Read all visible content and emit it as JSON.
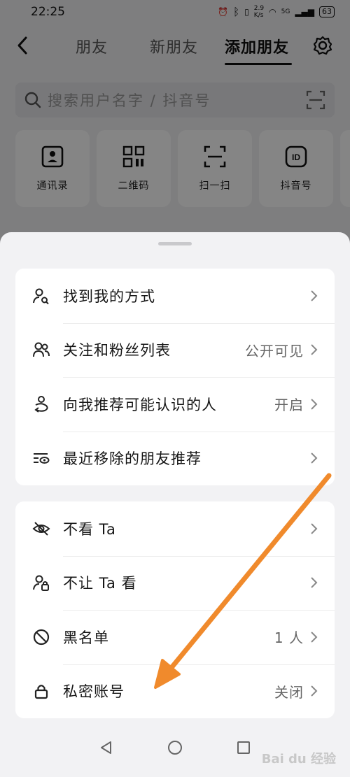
{
  "status_bar": {
    "time": "22:25",
    "net_speed_top": "2.9",
    "net_speed_unit": "K/s",
    "signal": "5G",
    "battery": "63"
  },
  "header": {
    "tabs": [
      {
        "label": "朋友"
      },
      {
        "label": "新朋友"
      },
      {
        "label": "添加朋友"
      }
    ],
    "active_tab": "添加朋友"
  },
  "search": {
    "placeholder": "搜索用户名字 / 抖音号"
  },
  "quick_actions": [
    {
      "label": "通讯录",
      "icon": "contacts-icon"
    },
    {
      "label": "二维码",
      "icon": "qr-code-icon"
    },
    {
      "label": "扫一扫",
      "icon": "scan-icon"
    },
    {
      "label": "抖音号",
      "icon": "id-icon"
    }
  ],
  "sheet": {
    "group1": [
      {
        "label": "找到我的方式",
        "value": "",
        "icon": "person-search-icon"
      },
      {
        "label": "关注和粉丝列表",
        "value": "公开可见",
        "icon": "people-icon"
      },
      {
        "label": "向我推荐可能认识的人",
        "value": "开启",
        "icon": "recommend-people-icon"
      },
      {
        "label": "最近移除的朋友推荐",
        "value": "",
        "icon": "list-eye-icon"
      }
    ],
    "group2": [
      {
        "label": "不看 Ta",
        "value": "",
        "icon": "eye-off-icon"
      },
      {
        "label": "不让 Ta 看",
        "value": "",
        "icon": "person-lock-icon"
      },
      {
        "label": "黑名单",
        "value": "1 人",
        "icon": "block-icon"
      },
      {
        "label": "私密账号",
        "value": "关闭",
        "icon": "lock-icon"
      }
    ]
  },
  "watermark": "Bai du 经验",
  "colors": {
    "annotation_arrow": "#f08a2c"
  }
}
